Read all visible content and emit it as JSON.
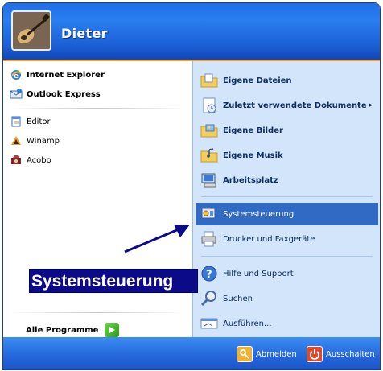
{
  "user": {
    "name": "Dieter"
  },
  "left_pane": {
    "pinned": [
      {
        "label": "Internet Explorer",
        "icon": "internet-explorer-icon"
      },
      {
        "label": "Outlook Express",
        "icon": "outlook-express-icon"
      }
    ],
    "recent": [
      {
        "label": "Editor",
        "icon": "notepad-icon"
      },
      {
        "label": "Winamp",
        "icon": "winamp-icon"
      },
      {
        "label": "Acobo",
        "icon": "acobo-icon"
      }
    ],
    "all_programs_label": "Alle Programme"
  },
  "right_pane": {
    "group1": [
      {
        "label": "Eigene Dateien",
        "icon": "my-documents-folder-icon"
      },
      {
        "label": "Zuletzt verwendete Dokumente",
        "icon": "recent-documents-icon",
        "submenu_arrow": "▸"
      },
      {
        "label": "Eigene Bilder",
        "icon": "my-pictures-folder-icon"
      },
      {
        "label": "Eigene Musik",
        "icon": "my-music-folder-icon"
      },
      {
        "label": "Arbeitsplatz",
        "icon": "my-computer-icon"
      }
    ],
    "group2": [
      {
        "label": "Systemsteuerung",
        "icon": "control-panel-icon",
        "selected": true
      },
      {
        "label": "Drucker und Faxgeräte",
        "icon": "printers-faxes-icon"
      }
    ],
    "group3": [
      {
        "label": "Hilfe und Support",
        "icon": "help-support-icon"
      },
      {
        "label": "Suchen",
        "icon": "search-icon"
      },
      {
        "label": "Ausführen...",
        "icon": "run-icon"
      }
    ]
  },
  "footer": {
    "logoff_label": "Abmelden",
    "shutdown_label": "Ausschalten"
  },
  "callout": {
    "text": "Systemsteuerung"
  },
  "colors": {
    "header_blue": "#2a7ef0",
    "footer_blue": "#2466da",
    "right_pane_bg": "#d3e5fa",
    "selection": "#316ac5",
    "callout_bg": "#0b0b8a",
    "separator_orange": "#f2a135"
  }
}
